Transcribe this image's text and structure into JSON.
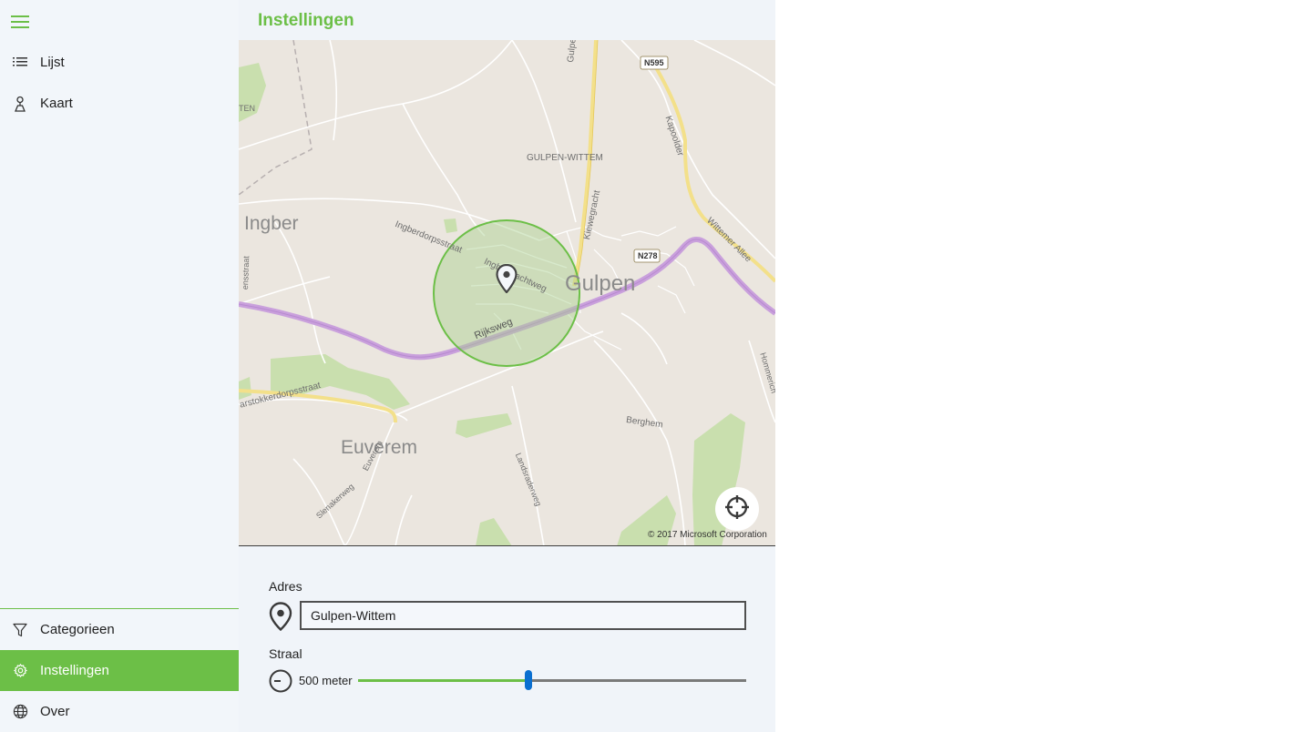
{
  "sidebar": {
    "menu_icon": "hamburger-icon",
    "top_items": [
      {
        "label": "Lijst",
        "icon": "list-icon"
      },
      {
        "label": "Kaart",
        "icon": "map-pin-icon"
      }
    ],
    "bottom_items": [
      {
        "label": "Categorieen",
        "icon": "filter-icon"
      },
      {
        "label": "Instellingen",
        "icon": "gear-icon",
        "active": true
      },
      {
        "label": "Over",
        "icon": "globe-icon"
      }
    ]
  },
  "page": {
    "title": "Instellingen"
  },
  "map": {
    "labels": {
      "gulpen": "Gulpen",
      "gulpen_wittem": "GULPEN-WITTEM",
      "ingber": "Ingber",
      "euverem": "Euverem",
      "berghem": "Berghem",
      "rijksweg": "Rijksweg",
      "ingbergrachtweg": "Ingbergrachtweg",
      "ingberdorpsstraat": "Ingberdorpsstraat",
      "gulpenerweg": "Gulpenerweg",
      "kapoolder": "Kapoolder",
      "kiewegracht": "Kiewegracht",
      "wittemer_allee": "Wittemer Allee",
      "hommerich": "Hommerich",
      "landsraderweg": "Landsraderweg",
      "stokkerdorpsstraat": "arstokkerdorpsstraat",
      "slenakerweg": "Slenakerweg",
      "euverem_road": "Euverem",
      "n595": "N595",
      "n278": "N278",
      "en_fragment": "TEN",
      "straat_fragment": "ensstraat"
    },
    "copyright": "© 2017 Microsoft Corporation",
    "locate_icon": "crosshair-icon",
    "pin_icon": "map-pin-icon",
    "colors": {
      "background": "#ebe6df",
      "radius_fill": "#a8d08d",
      "radius_stroke": "#6cbf47",
      "highway": "#c9a0dc",
      "main_road": "#f3e08a",
      "park": "#c9dfae"
    }
  },
  "form": {
    "address_label": "Adres",
    "address_value": "Gulpen-Wittem",
    "address_icon": "location-pin-icon",
    "radius_label": "Straal",
    "radius_icon": "radius-icon",
    "radius_value_text": "500 meter",
    "slider_fraction": 0.44
  },
  "colors": {
    "accent": "#6cbf47",
    "sidebar_bg": "#f2f6fa",
    "main_bg": "#f0f4f9",
    "slider_thumb": "#0a6fd0"
  }
}
